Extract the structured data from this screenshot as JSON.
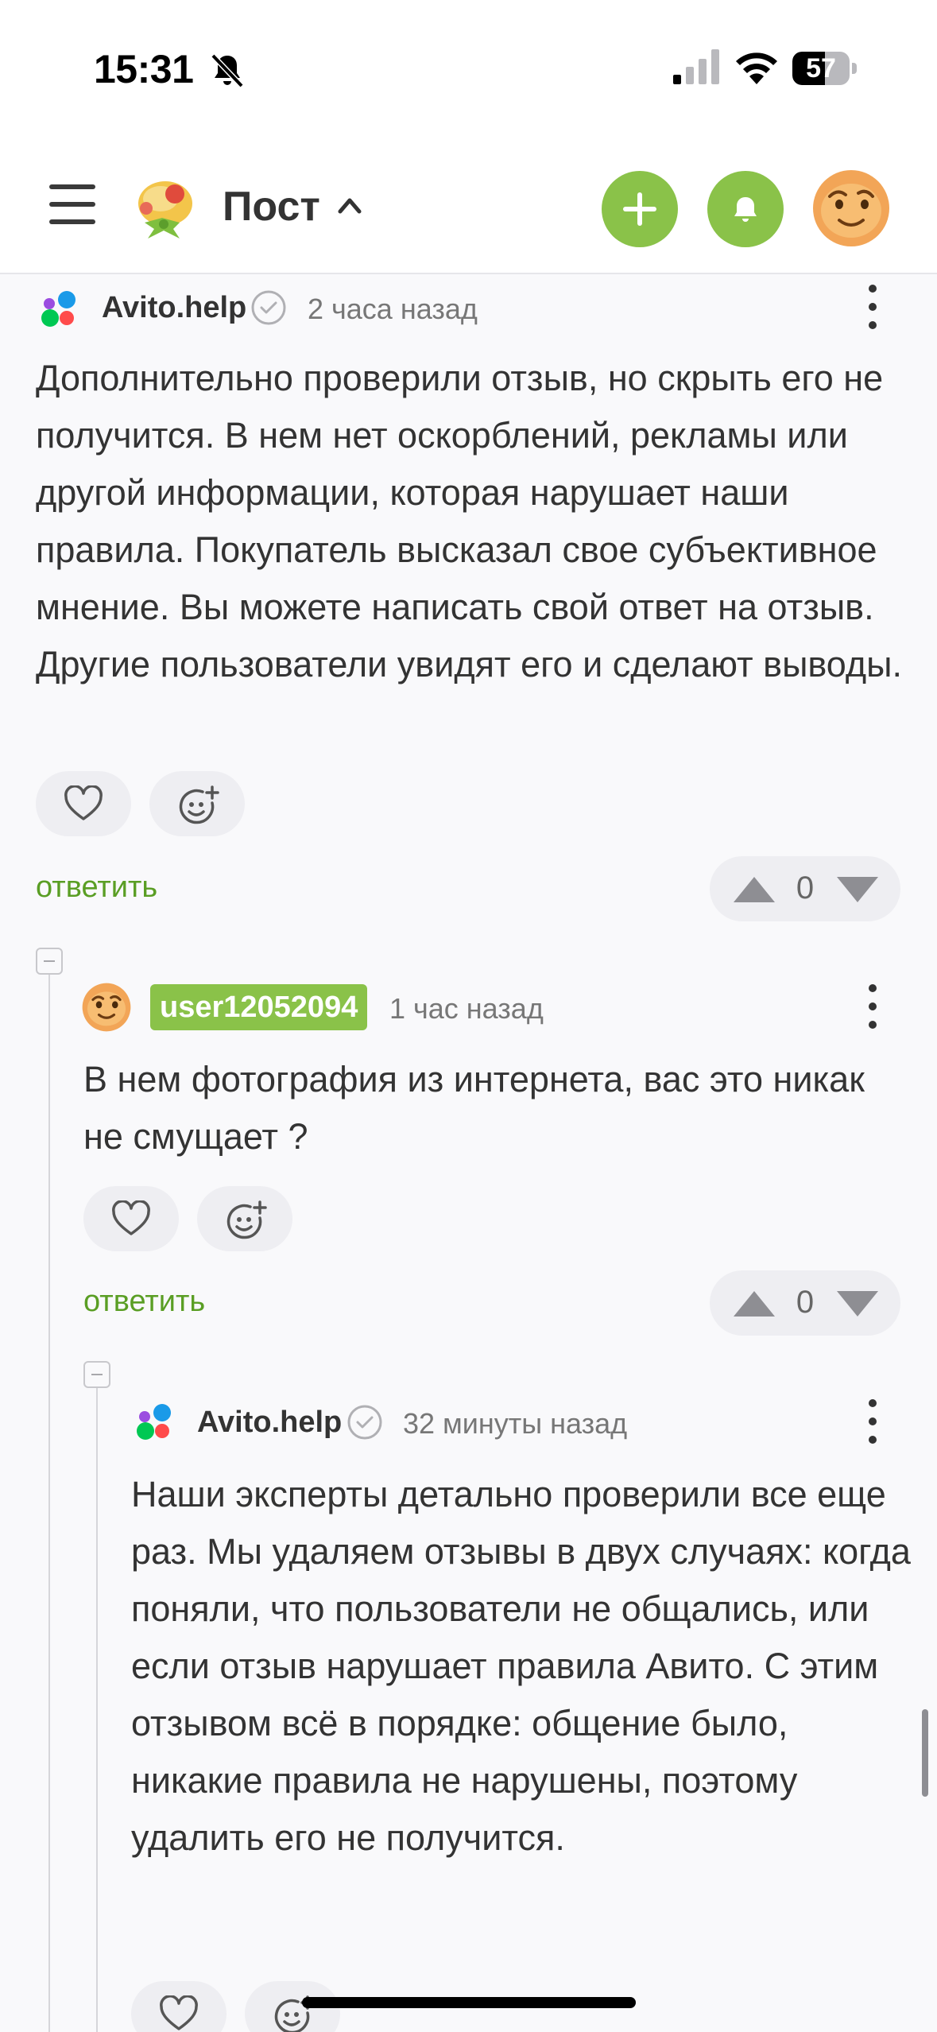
{
  "status_bar": {
    "time": "15:31",
    "battery": "57",
    "battery_level": 0.57
  },
  "header": {
    "title": "Пост"
  },
  "comments": [
    {
      "author": "Avito.help",
      "time": "2 часа назад",
      "text": "Дополнительно проверили отзыв, но скрыть его не получится. В нем нет оскорблений, рекламы или другой информации, которая нарушает наши правила. Покупатель высказал свое субъективное мнение. Вы можете написать свой ответ на отзыв. Другие пользователи увидят его и сделают выводы.",
      "reply_label": "ответить",
      "votes": "0"
    },
    {
      "author": "user12052094",
      "time": "1 час назад",
      "text": "В нем фотография из интернета, вас это никак не смущает ?",
      "reply_label": "ответить",
      "votes": "0"
    },
    {
      "author": "Avito.help",
      "time": "32 минуты назад",
      "text": "Наши эксперты детально проверили все еще раз. Мы удаляем отзывы в двух случаях: когда поняли, что пользователи не общались, или если отзыв нарушает правила Авито. С этим отзывом всё в порядке: общение было, никакие правила не нарушены, поэтому удалить его не получится."
    }
  ],
  "colors": {
    "accent": "#8ac249",
    "reply_link": "#5a9e24",
    "button_bg": "#eeeef2"
  },
  "icons": [
    "bell-off-icon",
    "signal-icon",
    "wifi-icon",
    "menu-icon",
    "chevron-up-icon",
    "plus-icon",
    "bell-icon",
    "heart-icon",
    "smile-add-icon",
    "verified-icon",
    "more-icon",
    "arrow-up-icon",
    "arrow-down-icon",
    "collapse-icon"
  ]
}
